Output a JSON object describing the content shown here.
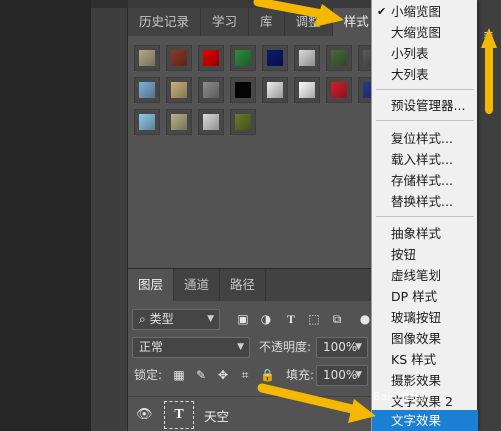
{
  "styles_panel": {
    "tabs": [
      "历史记录",
      "学习",
      "库",
      "调整",
      "样式"
    ],
    "active_tab": "样式",
    "swatches": [
      [
        "#b5a98a",
        "#8a3a22",
        "#e60000",
        "#2e8b3a",
        "#0a1a6e",
        "#d9d9d9",
        "#4a6a3a",
        "#5a5a5a"
      ],
      [
        "#7fb0d8",
        "#cbb27a",
        "#8c8c8c",
        "#050505",
        "#ececec",
        "#ffffff",
        "#d41f2a",
        "#2a3a8a"
      ],
      [
        "#8cc8e8",
        "#b8b08a",
        "#dcdcdc",
        "#6a7a2a"
      ]
    ]
  },
  "layers_panel": {
    "tabs": [
      "图层",
      "通道",
      "路径"
    ],
    "active_tab": "图层",
    "filter_label": "类型",
    "blend_mode": "正常",
    "opacity_label": "不透明度:",
    "opacity_value": "100%",
    "lock_label": "锁定:",
    "fill_label": "填充:",
    "fill_value": "100%",
    "layer_name": "天空",
    "layer_thumb": "T"
  },
  "menu": {
    "checked_item": "小缩览图",
    "group1": [
      "小缩览图",
      "大缩览图",
      "小列表",
      "大列表"
    ],
    "group2": [
      "预设管理器..."
    ],
    "group3": [
      "复位样式...",
      "载入样式...",
      "存储样式...",
      "替换样式..."
    ],
    "group4": [
      "抽象样式",
      "按钮",
      "虚线笔划",
      "DP 样式",
      "玻璃按钮",
      "图像效果",
      "KS 样式",
      "摄影效果",
      "文字效果 2",
      "文字效果"
    ],
    "highlighted_item": "文字效果"
  },
  "watermark": "Baidu经验",
  "colors": {
    "highlight": "#1b7fd4",
    "arrow": "#f5b800",
    "panel_bg": "#535353"
  }
}
